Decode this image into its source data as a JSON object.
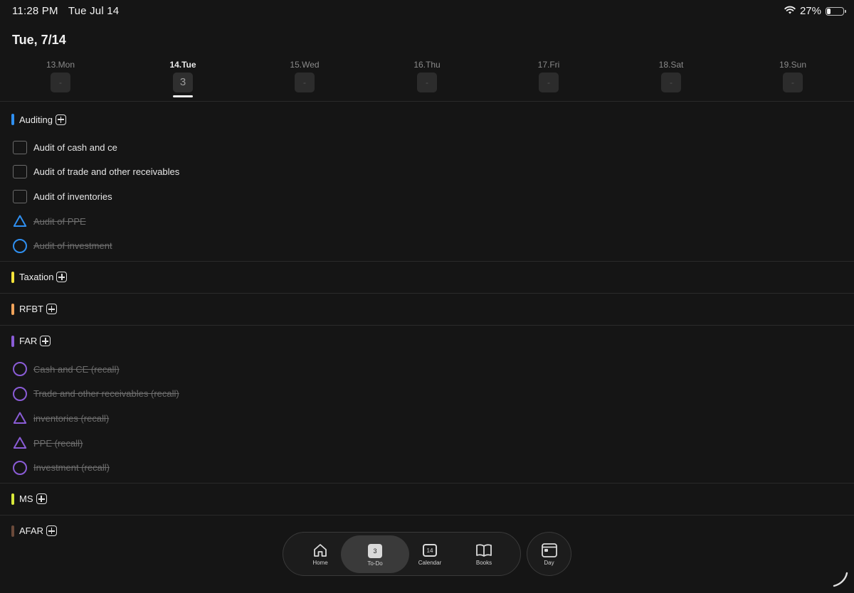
{
  "status": {
    "time": "11:28 PM",
    "date": "Tue Jul 14",
    "battery": "27%",
    "battery_level": 0.27
  },
  "header": {
    "title": "Tue, 7/14"
  },
  "week": [
    {
      "label": "13.Mon",
      "count": "-"
    },
    {
      "label": "14.Tue",
      "count": "3"
    },
    {
      "label": "15.Wed",
      "count": "-"
    },
    {
      "label": "16.Thu",
      "count": "-"
    },
    {
      "label": "17.Fri",
      "count": "-"
    },
    {
      "label": "18.Sat",
      "count": "-"
    },
    {
      "label": "19.Sun",
      "count": "-"
    }
  ],
  "categories": [
    {
      "name": "Auditing",
      "color": "#2f8ff0",
      "tasks": [
        {
          "label": "Audit of cash and ce",
          "mark": "square",
          "done": false
        },
        {
          "label": "Audit of trade and other receivables",
          "mark": "square",
          "done": false
        },
        {
          "label": "Audit of inventories",
          "mark": "square",
          "done": false
        },
        {
          "label": "Audit of PPE",
          "mark": "triangle",
          "done": true
        },
        {
          "label": "Audit of investment",
          "mark": "circle",
          "done": true
        }
      ]
    },
    {
      "name": "Taxation",
      "color": "#f3e23a",
      "tasks": []
    },
    {
      "name": "RFBT",
      "color": "#f0a35a",
      "tasks": []
    },
    {
      "name": "FAR",
      "color": "#8a5cd6",
      "tasks": [
        {
          "label": "Cash and CE (recall)",
          "mark": "circle",
          "done": true
        },
        {
          "label": "Trade and other receivables (recall)",
          "mark": "circle",
          "done": true
        },
        {
          "label": "inventories (recall)",
          "mark": "triangle",
          "done": true
        },
        {
          "label": "PPE (recall)",
          "mark": "triangle",
          "done": true
        },
        {
          "label": "Investment (recall)",
          "mark": "circle",
          "done": true
        }
      ]
    },
    {
      "name": "MS",
      "color": "#d8e83a",
      "tasks": []
    },
    {
      "name": "AFAR",
      "color": "#6b4a3a",
      "tasks": []
    }
  ],
  "tabbar": {
    "home": "Home",
    "todo": "To-Do",
    "todo_badge": "3",
    "calendar": "Calendar",
    "calendar_badge": "14",
    "books": "Books",
    "day": "Day"
  }
}
